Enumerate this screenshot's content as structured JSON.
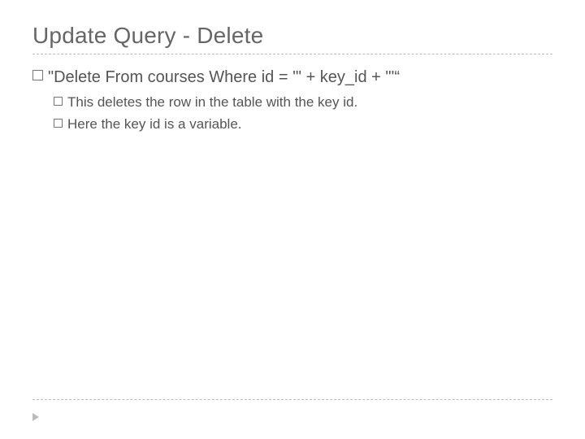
{
  "title": "Update Query - Delete",
  "bullets": {
    "main": "\"Delete From courses Where id = '\" + key_id + \"'“",
    "sub1": "This deletes the row in the table with the key id.",
    "sub2": "Here the key id is a variable."
  }
}
